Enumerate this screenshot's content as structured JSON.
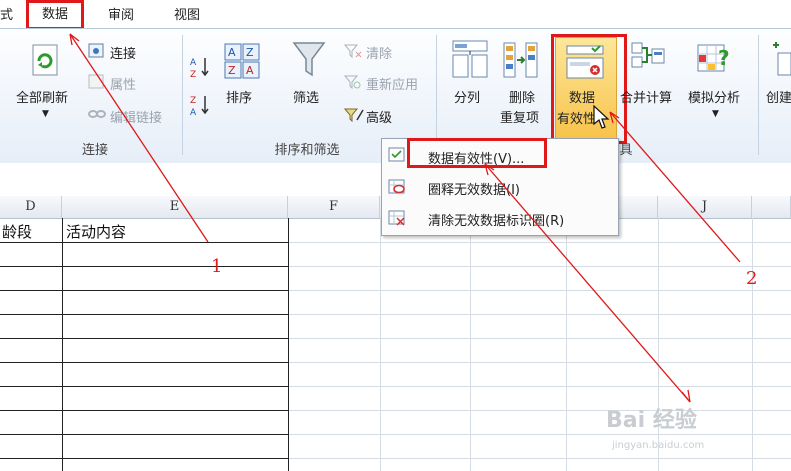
{
  "tabs": {
    "partial_left": "式",
    "data": "数据",
    "review": "审阅",
    "view": "视图"
  },
  "ribbon": {
    "connections": {
      "refresh_all": "全部刷新",
      "connections": "连接",
      "properties": "属性",
      "edit_links": "编辑链接",
      "group_label": "连接"
    },
    "sort_filter": {
      "sort": "排序",
      "filter": "筛选",
      "clear": "清除",
      "reapply": "重新应用",
      "advanced": "高级",
      "group_label": "排序和筛选"
    },
    "data_tools": {
      "text_to_columns": "分列",
      "remove_dup_line1": "删除",
      "remove_dup_line2": "重复项",
      "validation_line1": "数据",
      "validation_line2": "有效性",
      "consolidate": "合并计算",
      "what_if": "模拟分析",
      "group_label_partial": "具"
    },
    "outline": {
      "create_partial": "创建"
    }
  },
  "menu": {
    "items": [
      {
        "label": "数据有效性(V)..."
      },
      {
        "label": "圈释无效数据(I)"
      },
      {
        "label": "清除无效数据标识圈(R)"
      }
    ]
  },
  "sheet": {
    "columns": [
      "D",
      "E",
      "F",
      "",
      "J"
    ],
    "header_cells": {
      "d": "龄段",
      "e": "活动内容"
    }
  },
  "annotations": {
    "step1": "1",
    "step2": "2"
  },
  "watermark": {
    "brand": "Bai 经验",
    "sub": "jingyan.baidu.com"
  },
  "colors": {
    "annotation_red": "#e01818",
    "highlight_yellow": "#fbd35a"
  }
}
